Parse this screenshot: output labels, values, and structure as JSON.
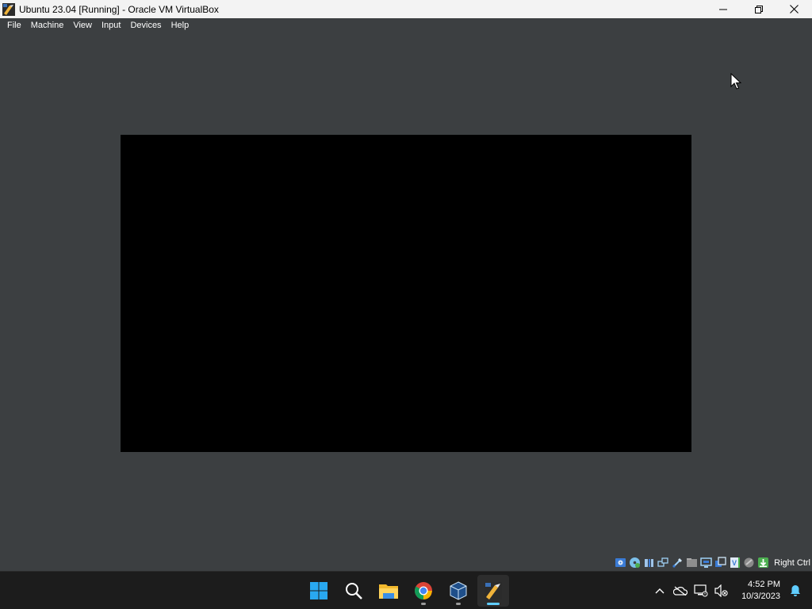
{
  "window": {
    "title": "Ubuntu 23.04 [Running] - Oracle VM VirtualBox",
    "controls": [
      "minimize-icon",
      "restore-icon",
      "close-icon"
    ]
  },
  "menu": {
    "file": "File",
    "machine": "Machine",
    "view": "View",
    "input": "Input",
    "devices": "Devices",
    "help": "Help"
  },
  "vm_display": {
    "screen_color": "#000000",
    "background_color": "#3c3f41"
  },
  "statusbar": {
    "icons": [
      "hard-disk-icon",
      "optical-drive-icon",
      "audio-icon",
      "network-icon",
      "usb-icon",
      "shared-folders-icon",
      "display-icon",
      "recording-icon",
      "virtualization-icon",
      "mouse-integration-icon",
      "keyboard-capture-icon"
    ],
    "host_key": "Right Ctrl"
  },
  "taskbar": {
    "apps": [
      "start-icon",
      "search-icon",
      "file-explorer-icon",
      "chrome-icon",
      "virtualbox-manager-icon",
      "virtualbox-vm-icon"
    ],
    "tray_icons": [
      "show-hidden-icons-icon",
      "onedrive-icon",
      "network-icon",
      "volume-muted-icon"
    ],
    "time": "4:52 PM",
    "date": "10/3/2023"
  },
  "colors": {
    "titlebar_bg": "#f3f3f3",
    "chrome_bg": "#3c3f41",
    "taskbar_bg": "#1c1c1c",
    "accent": "#60cdff"
  }
}
